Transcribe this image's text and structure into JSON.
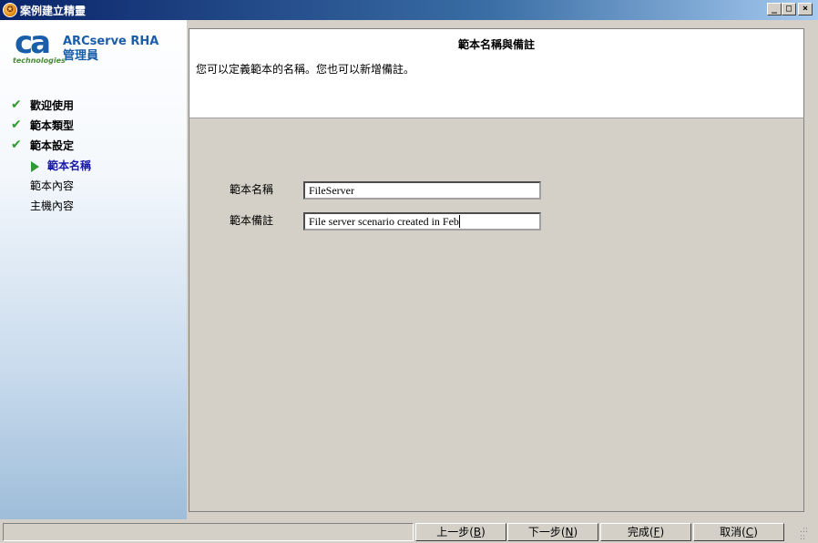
{
  "window": {
    "title": "案例建立精靈",
    "controls": {
      "minimize": "_",
      "maximize": "□",
      "close": "×"
    }
  },
  "sidebar": {
    "logo_text": "ca",
    "logo_subtext": "technologies",
    "product_line1": "ARCserve RHA",
    "product_line2": "管理員",
    "steps": [
      {
        "label": "歡迎使用",
        "status": "done"
      },
      {
        "label": "範本類型",
        "status": "done"
      },
      {
        "label": "範本設定",
        "status": "done"
      },
      {
        "label": "範本名稱",
        "status": "current"
      },
      {
        "label": "範本內容",
        "status": "pending"
      },
      {
        "label": "主機內容",
        "status": "pending"
      }
    ]
  },
  "header": {
    "title": "範本名稱與備註",
    "description": "您可以定義範本的名稱。您也可以新增備註。"
  },
  "form": {
    "name_label": "範本名稱",
    "name_value": "FileServer",
    "comment_label": "範本備註",
    "comment_value": "File server scenario created in Feb"
  },
  "footer": {
    "back": {
      "text": "上一步(",
      "key": "B",
      "end": ")"
    },
    "next": {
      "text": "下一步(",
      "key": "N",
      "end": ")"
    },
    "finish": {
      "text": "完成(",
      "key": "F",
      "end": ")"
    },
    "cancel": {
      "text": "取消(",
      "key": "C",
      "end": ")"
    }
  },
  "colors": {
    "titlebar_start": "#0a246a",
    "brand_blue": "#1a5da8",
    "check_green": "#2f9a2f",
    "current_step": "#1a1aa8",
    "panel_gray": "#d4d0c8"
  }
}
